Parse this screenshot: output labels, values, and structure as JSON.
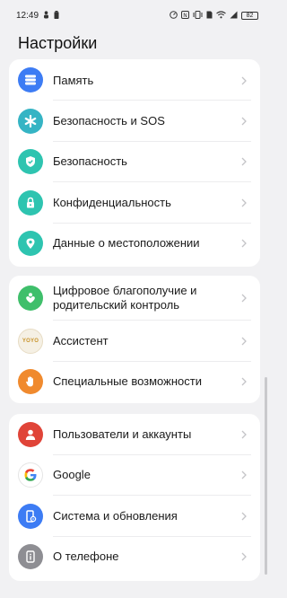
{
  "status": {
    "time": "12:49",
    "battery": "82"
  },
  "title": "Настройки",
  "groups": [
    {
      "items": [
        {
          "label": "Память",
          "icon": "storage-icon",
          "color": "#3d7cf4"
        },
        {
          "label": "Безопасность и SOS",
          "icon": "sos-icon",
          "color": "#35b4c4"
        },
        {
          "label": "Безопасность",
          "icon": "shield-icon",
          "color": "#2ec4b0"
        },
        {
          "label": "Конфиденциальность",
          "icon": "lock-icon",
          "color": "#2ec4b0"
        },
        {
          "label": "Данные о местоположении",
          "icon": "location-icon",
          "color": "#2ec4b0"
        }
      ]
    },
    {
      "items": [
        {
          "label": "Цифровое благополучие и родительский контроль",
          "icon": "wellbeing-icon",
          "color": "#3fbf6b"
        },
        {
          "label": "Ассистент",
          "icon": "assistant-icon",
          "color": "#f5f0e4",
          "badge": "YOYO"
        },
        {
          "label": "Специальные возможности",
          "icon": "hand-icon",
          "color": "#f08a2e"
        }
      ]
    },
    {
      "items": [
        {
          "label": "Пользователи и аккаунты",
          "icon": "user-icon",
          "color": "#e04438"
        },
        {
          "label": "Google",
          "icon": "google-icon",
          "color": "#ffffff",
          "badge": "G"
        },
        {
          "label": "Система и обновления",
          "icon": "system-icon",
          "color": "#3d7cf4"
        },
        {
          "label": "О телефоне",
          "icon": "info-icon",
          "color": "#8e8e93"
        }
      ]
    }
  ]
}
